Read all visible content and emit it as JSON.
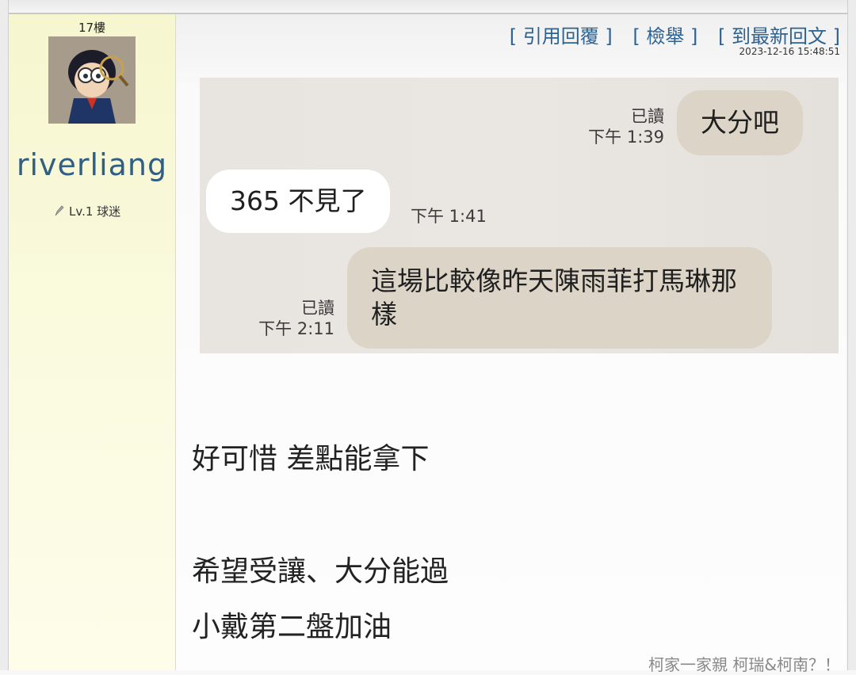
{
  "author": {
    "floor": "17樓",
    "username": "riverliang",
    "level": "Lv.1 球迷",
    "avatar_icon": "detective-avatar"
  },
  "post": {
    "actions": [
      "[ 引用回覆 ]",
      "[ 檢舉 ]",
      "[ 到最新回文 ]"
    ],
    "timestamp": "2023-12-16 15:48:51",
    "chat": [
      {
        "side": "out",
        "text": "大分吧",
        "read": "已讀",
        "time": "下午 1:39"
      },
      {
        "side": "in",
        "text": "365 不見了",
        "time": "下午 1:41"
      },
      {
        "side": "out",
        "text_line1": "這場比較像昨天陳雨菲打馬琳那",
        "text_line2": "樣",
        "read": "已讀",
        "time": "下午 2:11"
      }
    ],
    "body": [
      "好可惜 差點能拿下",
      "希望受讓、大分能過",
      "小戴第二盤加油"
    ],
    "signature": "柯家一家親 柯瑞&柯南？！"
  },
  "colors": {
    "author_bg": "#f8f8d6",
    "username": "#2f5f86",
    "action_link": "#2e6290",
    "bubble_out": "#dcd4c7",
    "bubble_in": "#ffffff"
  }
}
